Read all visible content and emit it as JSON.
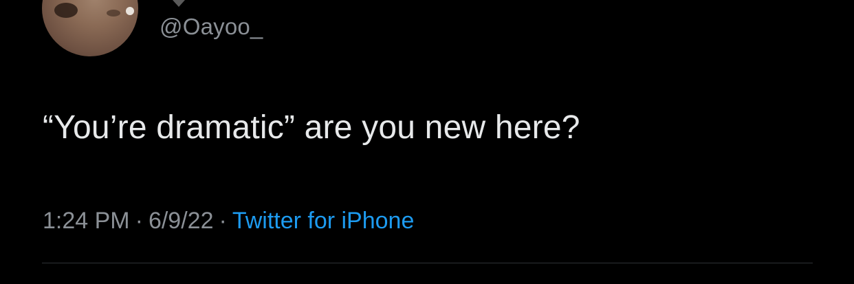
{
  "author": {
    "handle": "@Oayoo_"
  },
  "tweet": {
    "text": "“You’re dramatic” are you new here?"
  },
  "meta": {
    "time": "1:24 PM",
    "separator": "·",
    "date": "6/9/22",
    "source": "Twitter for iPhone"
  },
  "colors": {
    "background": "#000000",
    "text_primary": "#e7e9ea",
    "text_secondary": "#8b9096",
    "link": "#1d9bf0",
    "divider": "#2f3336"
  }
}
